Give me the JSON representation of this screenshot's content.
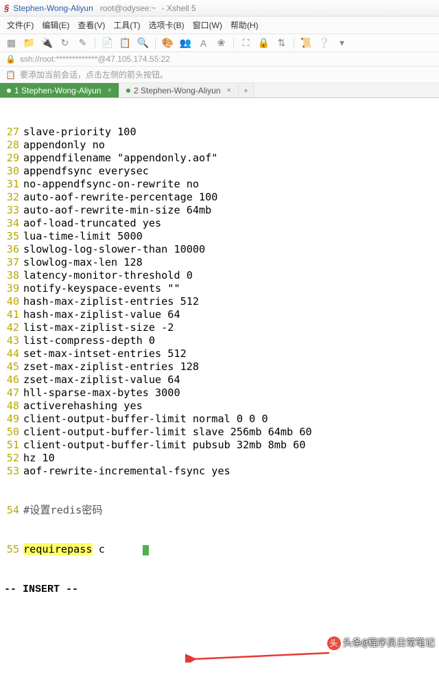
{
  "title": {
    "session": "Stephen-Wong-Aliyun",
    "host": "root@odysee:~",
    "app": "- Xshell 5"
  },
  "menu": {
    "file": "文件(F)",
    "edit": "编辑(E)",
    "view": "查看(V)",
    "tools": "工具(T)",
    "tabs": "选项卡(B)",
    "window": "窗口(W)",
    "help": "帮助(H)"
  },
  "address": {
    "text": "ssh://root:*************@47.105.174.55:22"
  },
  "hint": {
    "text": "要添加当前会话，点击左侧的箭头按钮。"
  },
  "tabs": {
    "items": [
      {
        "label": "1 Stephen-Wong-Aliyun",
        "active": true
      },
      {
        "label": "2 Stephen-Wong-Aliyun",
        "active": false
      }
    ]
  },
  "editor": {
    "lines": [
      {
        "n": "27",
        "t": "slave-priority 100"
      },
      {
        "n": "28",
        "t": "appendonly no"
      },
      {
        "n": "29",
        "t": "appendfilename \"appendonly.aof\""
      },
      {
        "n": "30",
        "t": "appendfsync everysec"
      },
      {
        "n": "31",
        "t": "no-appendfsync-on-rewrite no"
      },
      {
        "n": "32",
        "t": "auto-aof-rewrite-percentage 100"
      },
      {
        "n": "33",
        "t": "auto-aof-rewrite-min-size 64mb"
      },
      {
        "n": "34",
        "t": "aof-load-truncated yes"
      },
      {
        "n": "35",
        "t": "lua-time-limit 5000"
      },
      {
        "n": "36",
        "t": "slowlog-log-slower-than 10000"
      },
      {
        "n": "37",
        "t": "slowlog-max-len 128"
      },
      {
        "n": "38",
        "t": "latency-monitor-threshold 0"
      },
      {
        "n": "39",
        "t": "notify-keyspace-events \"\""
      },
      {
        "n": "40",
        "t": "hash-max-ziplist-entries 512"
      },
      {
        "n": "41",
        "t": "hash-max-ziplist-value 64"
      },
      {
        "n": "42",
        "t": "list-max-ziplist-size -2"
      },
      {
        "n": "43",
        "t": "list-compress-depth 0"
      },
      {
        "n": "44",
        "t": "set-max-intset-entries 512"
      },
      {
        "n": "45",
        "t": "zset-max-ziplist-entries 128"
      },
      {
        "n": "46",
        "t": "zset-max-ziplist-value 64"
      },
      {
        "n": "47",
        "t": "hll-sparse-max-bytes 3000"
      },
      {
        "n": "48",
        "t": "activerehashing yes"
      },
      {
        "n": "49",
        "t": "client-output-buffer-limit normal 0 0 0"
      },
      {
        "n": "50",
        "t": "client-output-buffer-limit slave 256mb 64mb 60"
      },
      {
        "n": "51",
        "t": "client-output-buffer-limit pubsub 32mb 8mb 60"
      },
      {
        "n": "52",
        "t": "hz 10"
      },
      {
        "n": "53",
        "t": "aof-rewrite-incremental-fsync yes"
      }
    ],
    "comment": {
      "n": "54",
      "t": "#设置redis密码"
    },
    "password": {
      "n": "55",
      "key": "requirepass",
      "sep": " ",
      "mask": "c      "
    },
    "mode": "-- INSERT --"
  },
  "watermark": {
    "prefix": "头条",
    "text": "@程序员日常笔记"
  }
}
